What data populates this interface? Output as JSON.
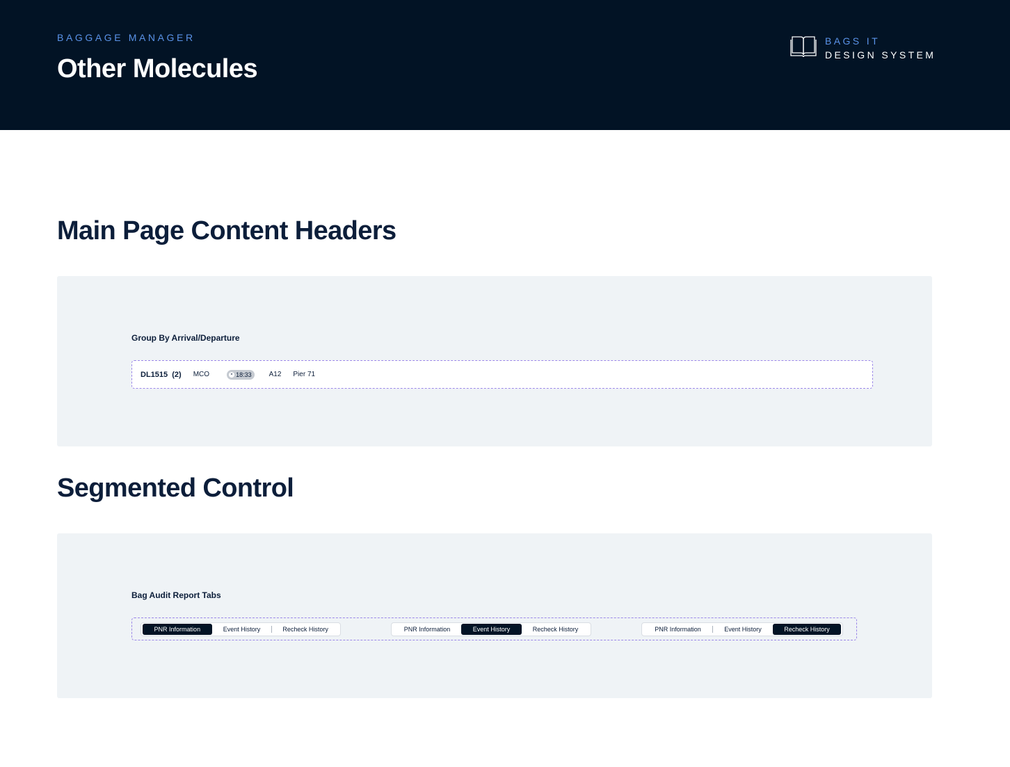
{
  "header": {
    "eyebrow": "BAGGAGE MANAGER",
    "title": "Other Molecules",
    "brand_line1": "BAGS IT",
    "brand_line2": "DESIGN SYSTEM",
    "brand_icon": "open-book-icon"
  },
  "sections": [
    {
      "title": "Main Page Content Headers",
      "label": "Group By Arrival/Departure",
      "flight": {
        "number": "DL1515",
        "count": "(2)",
        "origin": "MCO",
        "time": "18:33",
        "gate": "A12",
        "pier": "Pier 71"
      }
    },
    {
      "title": "Segmented Control",
      "label": "Bag Audit Report Tabs",
      "controls": [
        {
          "tabs": [
            "PNR Information",
            "Event History",
            "Recheck History"
          ],
          "active": 0
        },
        {
          "tabs": [
            "PNR Information",
            "Event History",
            "Recheck History"
          ],
          "active": 1
        },
        {
          "tabs": [
            "PNR Information",
            "Event History",
            "Recheck History"
          ],
          "active": 2
        }
      ]
    }
  ],
  "colors": {
    "navy": "#021325",
    "accent_blue": "#5a93e8",
    "panel_bg": "#eff3f6",
    "dashed_outline": "#9b87e8"
  }
}
